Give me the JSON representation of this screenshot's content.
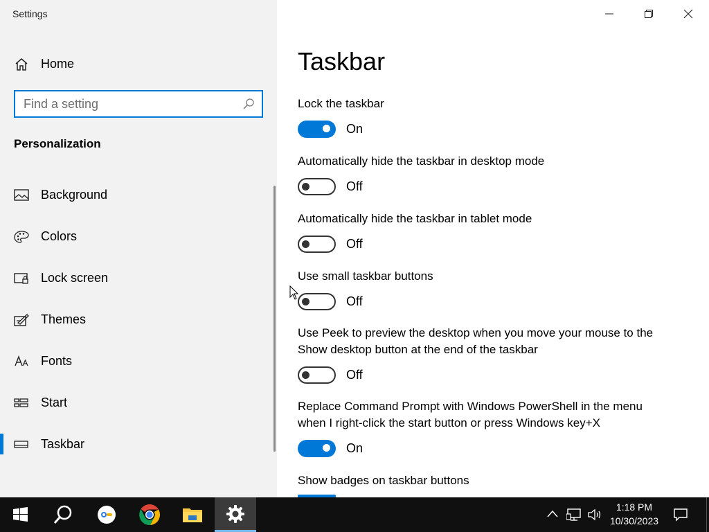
{
  "window": {
    "title": "Settings",
    "controls": [
      "minimize",
      "restore",
      "close"
    ]
  },
  "sidebar": {
    "home_label": "Home",
    "search_placeholder": "Find a setting",
    "section_title": "Personalization",
    "items": [
      {
        "label": "Background",
        "icon": "picture-icon"
      },
      {
        "label": "Colors",
        "icon": "palette-icon"
      },
      {
        "label": "Lock screen",
        "icon": "lock-screen-icon"
      },
      {
        "label": "Themes",
        "icon": "themes-icon"
      },
      {
        "label": "Fonts",
        "icon": "fonts-icon"
      },
      {
        "label": "Start",
        "icon": "start-icon"
      },
      {
        "label": "Taskbar",
        "icon": "taskbar-icon",
        "active": true
      }
    ]
  },
  "main": {
    "title": "Taskbar",
    "settings": [
      {
        "label": "Lock the taskbar",
        "state": "On"
      },
      {
        "label": "Automatically hide the taskbar in desktop mode",
        "state": "Off"
      },
      {
        "label": "Automatically hide the taskbar in tablet mode",
        "state": "Off"
      },
      {
        "label": "Use small taskbar buttons",
        "state": "Off"
      },
      {
        "label": "Use Peek to preview the desktop when you move your mouse to the Show desktop button at the end of the taskbar",
        "state": "Off"
      },
      {
        "label": "Replace Command Prompt with Windows PowerShell in the menu when I right-click the start button or press Windows key+X",
        "state": "On"
      },
      {
        "label": "Show badges on taskbar buttons",
        "state": "On"
      }
    ]
  },
  "taskbar": {
    "apps": [
      "start-icon",
      "search-icon",
      "media-app-icon",
      "chrome-icon",
      "file-explorer-icon",
      "settings-gear-icon"
    ],
    "clock_time": "1:18 PM",
    "clock_date": "10/30/2023"
  },
  "colors": {
    "accent": "#0078d7",
    "sidebar_bg": "#f2f2f2",
    "taskbar_bg": "#101010"
  }
}
